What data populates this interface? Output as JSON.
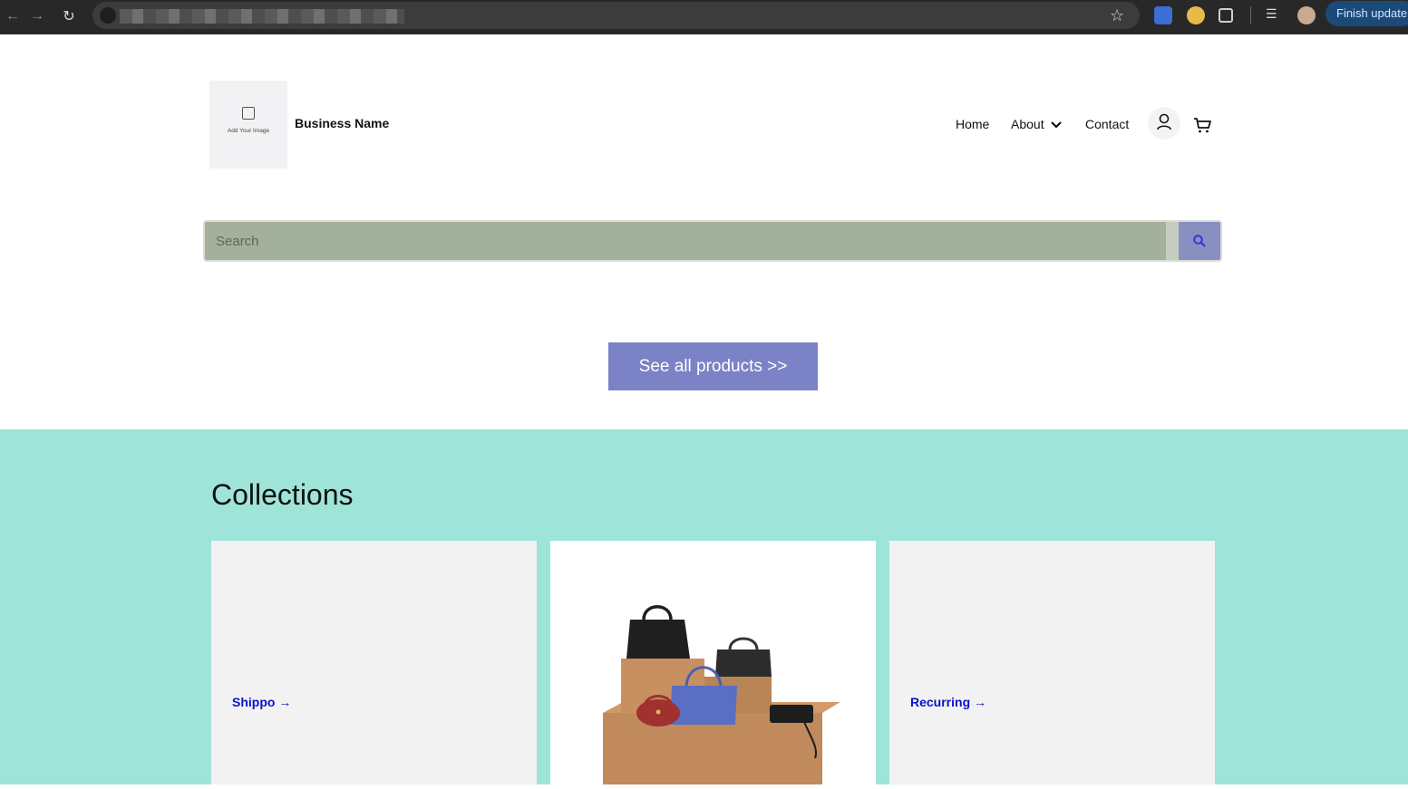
{
  "browser": {
    "finish_update_label": "Finish update",
    "icons": [
      "back-icon",
      "forward-icon",
      "reload-icon",
      "site-info-icon",
      "bookmark-star-icon",
      "extension-icon",
      "puzzle-icon",
      "media-icon",
      "profile-icon"
    ]
  },
  "header": {
    "logo_placeholder_label": "Add Your Image",
    "business_name": "Business Name",
    "nav": {
      "home": "Home",
      "about": "About",
      "contact": "Contact"
    }
  },
  "search": {
    "placeholder": "Search"
  },
  "cta": {
    "label": "See all products >>"
  },
  "collections": {
    "title": "Collections",
    "cards": [
      {
        "label": "Shippo →"
      },
      {
        "label": ""
      },
      {
        "label": "Recurring →"
      }
    ]
  },
  "colors": {
    "collections_bg": "#9fe4d9",
    "cta_bg": "#7b82c6",
    "search_bg": "#a3b09c",
    "link": "#0a12c9"
  }
}
